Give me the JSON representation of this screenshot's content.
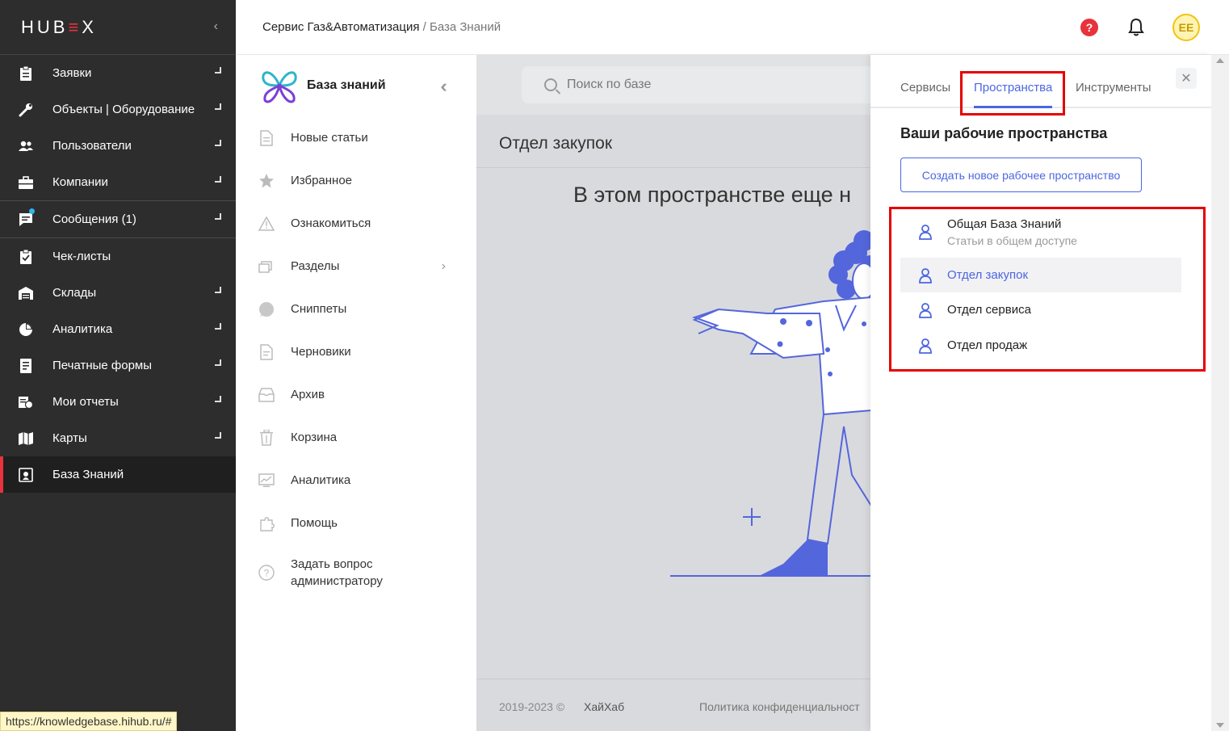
{
  "app": {
    "logo_text": "HUBEX",
    "url_tooltip": "https://knowledgebase.hihub.ru/#"
  },
  "sidebar": {
    "items": [
      {
        "label": "Заявки",
        "icon": "clipboard-icon"
      },
      {
        "label": "Объекты | Оборудование",
        "icon": "wrench-icon"
      },
      {
        "label": "Пользователи",
        "icon": "users-icon"
      },
      {
        "label": "Компании",
        "icon": "briefcase-icon"
      },
      {
        "label": "Сообщения (1)",
        "icon": "message-icon"
      },
      {
        "label": "Чек-листы",
        "icon": "checklist-icon"
      },
      {
        "label": "Склады",
        "icon": "warehouse-icon"
      },
      {
        "label": "Аналитика",
        "icon": "pie-chart-icon"
      },
      {
        "label": "Печатные формы",
        "icon": "print-form-icon"
      },
      {
        "label": "Мои отчеты",
        "icon": "reports-icon"
      },
      {
        "label": "Карты",
        "icon": "map-icon"
      },
      {
        "label": "База Знаний",
        "icon": "knowledge-icon"
      }
    ]
  },
  "header": {
    "breadcrumb_root": "Сервис Газ&Автоматизация",
    "breadcrumb_sep": " / ",
    "breadcrumb_current": "База Знаний",
    "help_glyph": "?",
    "avatar_initials": "EE"
  },
  "kb_nav": {
    "title": "База знаний",
    "items": [
      {
        "label": "Новые статьи",
        "icon": "document-icon"
      },
      {
        "label": "Избранное",
        "icon": "star-icon"
      },
      {
        "label": "Ознакомиться",
        "icon": "warning-icon"
      },
      {
        "label": "Разделы",
        "icon": "sections-icon"
      },
      {
        "label": "Сниппеты",
        "icon": "snippet-icon"
      },
      {
        "label": "Черновики",
        "icon": "draft-icon"
      },
      {
        "label": "Архив",
        "icon": "archive-icon"
      },
      {
        "label": "Корзина",
        "icon": "trash-icon"
      },
      {
        "label": "Аналитика",
        "icon": "analytics-icon"
      },
      {
        "label": "Помощь",
        "icon": "help-puzzle-icon"
      },
      {
        "label": "Задать вопрос администратору",
        "icon": "question-icon"
      }
    ]
  },
  "main": {
    "search_placeholder": "Поиск по базе",
    "section_title": "Отдел закупок",
    "empty_text": "В этом пространстве еще н",
    "footer_years": "2019-2023 ©",
    "footer_company": "ХайХаб",
    "footer_policy": "Политика конфиденциальност"
  },
  "panel": {
    "tabs": [
      "Сервисы",
      "Пространства",
      "Инструменты"
    ],
    "active_tab": "Пространства",
    "close_glyph": "✕",
    "heading": "Ваши рабочие пространства",
    "create_button": "Создать новое рабочее пространство",
    "workspaces": [
      {
        "name": "Общая База Знаний",
        "subtitle": "Статьи в общем доступе"
      },
      {
        "name": "Отдел закупок",
        "selected": true
      },
      {
        "name": "Отдел сервиса"
      },
      {
        "name": "Отдел продаж"
      }
    ]
  },
  "colors": {
    "accent": "#4c66e0",
    "brand_red": "#e8323c",
    "highlight": "#e50000",
    "sidebar_bg": "#2d2d2d"
  }
}
